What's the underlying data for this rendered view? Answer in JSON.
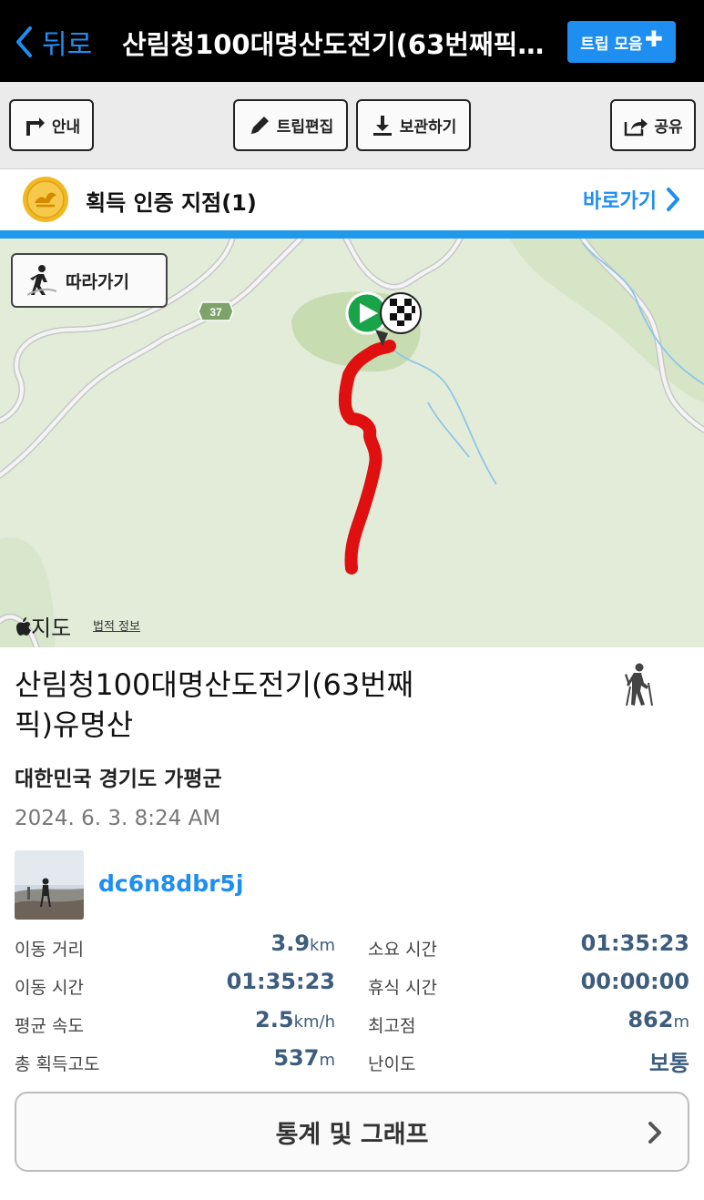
{
  "header": {
    "back_label": "뒤로",
    "title": "산림청100대명산도전기(63번째픽)유명산",
    "trip_collection_label": "트립 모음",
    "trip_collection_plus": "✚"
  },
  "toolbar": {
    "guide_label": "안내",
    "edit_label": "트립편집",
    "save_label": "보관하기",
    "share_label": "공유"
  },
  "certification": {
    "label": "획득 인증 지점(1)",
    "goto_label": "바로가기"
  },
  "map": {
    "follow_label": "따라가기",
    "provider_label": "지도",
    "legal_label": "법적 정보",
    "road_number": "37",
    "track_color": "#e01010"
  },
  "trip": {
    "name": "산림청100대명산도전기(63번째픽)유명산",
    "location": "대한민국 경기도 가평군",
    "datetime": "2024. 6. 3. 8:24 AM",
    "username": "dc6n8dbr5j",
    "activity_icon": "hiking-icon"
  },
  "stats": {
    "distance_label": "이동 거리",
    "distance_value": "3.9",
    "distance_unit": "km",
    "duration_label": "소요 시간",
    "duration_value": "01:35:23",
    "moving_time_label": "이동 시간",
    "moving_time_value": "01:35:23",
    "rest_time_label": "휴식 시간",
    "rest_time_value": "00:00:00",
    "avg_speed_label": "평균 속도",
    "avg_speed_value": "2.5",
    "avg_speed_unit": "km/h",
    "max_elev_label": "최고점",
    "max_elev_value": "862",
    "max_elev_unit": "m",
    "total_gain_label": "총 획득고도",
    "total_gain_value": "537",
    "total_gain_unit": "m",
    "difficulty_label": "난이도",
    "difficulty_value": "보통"
  },
  "stats_button_label": "통계 및 그래프",
  "colors": {
    "accent": "#1f8ef1",
    "stat_value": "#3d5d7e",
    "header_bg": "#000000"
  }
}
